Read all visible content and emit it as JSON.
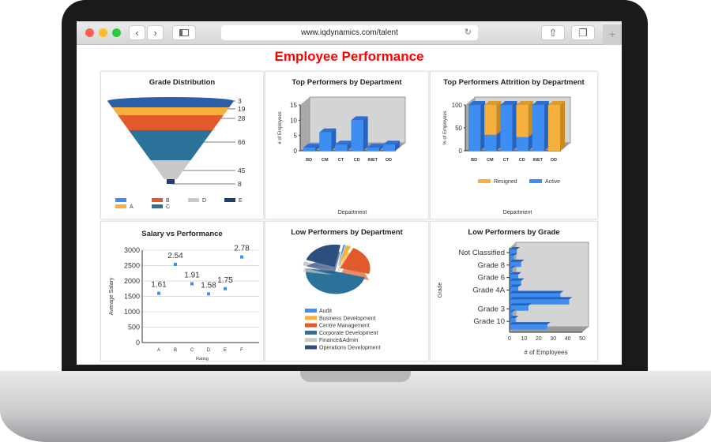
{
  "browser": {
    "url": "www.iqdynamics.com/talent",
    "back": "‹",
    "forward": "›",
    "new_tab": "+"
  },
  "page": {
    "title": "Employee Performance"
  },
  "colors": {
    "blue": "#3d8ef0",
    "orange": "#f6b03d",
    "red": "#e05a2b",
    "teal": "#2a7299",
    "gray": "#c8c8c8",
    "navy": "#1f3d6e"
  },
  "chart_data": [
    {
      "type": "funnel",
      "title": "Grade Distribution",
      "values": [
        3,
        19,
        28,
        66,
        45,
        8
      ],
      "colors": [
        "#2b5fa8",
        "#f6b03d",
        "#e05a2b",
        "#2a7299",
        "#c8c8c8",
        "#1f3d6e"
      ],
      "legend": [
        {
          "label": "",
          "color": "#3d8ef0"
        },
        {
          "label": "B",
          "color": "#e05a2b"
        },
        {
          "label": "D",
          "color": "#c8c8c8"
        },
        {
          "label": "E",
          "color": "#1f3d6e"
        },
        {
          "label": "A",
          "color": "#f6b03d"
        },
        {
          "label": "C",
          "color": "#2a7299"
        }
      ]
    },
    {
      "type": "bar",
      "title": "Top Performers by Department",
      "categories": [
        "BD",
        "CM",
        "CT",
        "CD",
        "INET",
        "OD"
      ],
      "values": [
        1,
        6,
        2,
        10,
        1,
        2
      ],
      "ylim": [
        0,
        15
      ],
      "yticks": [
        "0",
        "5",
        "10",
        "15"
      ],
      "xlabel": "Department",
      "ylabel": "# of Employees"
    },
    {
      "type": "bar",
      "stacked": true,
      "title": "Top Performers Attrition by Department",
      "categories": [
        "BD",
        "CM",
        "CT",
        "CD",
        "INET",
        "OD"
      ],
      "series": [
        {
          "name": "Active",
          "values": [
            100,
            35,
            100,
            30,
            100,
            0
          ]
        },
        {
          "name": "Resigned",
          "values": [
            0,
            65,
            0,
            70,
            0,
            100
          ]
        }
      ],
      "ylim": [
        0,
        100
      ],
      "yticks": [
        "0",
        "50",
        "100"
      ],
      "xlabel": "Department",
      "ylabel": "% of Employees"
    },
    {
      "type": "scatter",
      "title": "Salary vs Performance",
      "categories": [
        "A",
        "B",
        "C",
        "D",
        "E",
        "F"
      ],
      "values": [
        1600,
        2540,
        1910,
        1580,
        1750,
        2780
      ],
      "labels": [
        "1.61",
        "2.54",
        "1.91",
        "1.58",
        "1.75",
        "2.78"
      ],
      "ylim": [
        0,
        3000
      ],
      "yticks": [
        "0",
        "500",
        "1000",
        "1500",
        "2000",
        "2500",
        "3000"
      ],
      "xlabel": "Rating",
      "ylabel": "Average Salary"
    },
    {
      "type": "pie",
      "title": "Low Performers by Department",
      "slices": [
        {
          "label": "Audit",
          "value": 1,
          "color": "#3d8ef0"
        },
        {
          "label": "Business Development",
          "value": 3,
          "color": "#f6b03d"
        },
        {
          "label": "Centre Management",
          "value": 22,
          "color": "#e05a2b"
        },
        {
          "label": "Corporate Development",
          "value": 48,
          "color": "#2a7299"
        },
        {
          "label": "Finance&Admin",
          "value": 3,
          "color": "#c8c8c8"
        },
        {
          "label": "Operations Development",
          "value": 23,
          "color": "#2d4f80"
        }
      ]
    },
    {
      "type": "bar",
      "orientation": "horizontal",
      "title": "Low Performers by Grade",
      "bars": [
        {
          "label": "Not Classified",
          "value": 5
        },
        {
          "label": "",
          "value": 3
        },
        {
          "label": "Grade 8",
          "value": 8
        },
        {
          "label": "",
          "value": 2
        },
        {
          "label": "Grade 6",
          "value": 6
        },
        {
          "label": "",
          "value": 8
        },
        {
          "label": "Grade 4A",
          "value": 6
        },
        {
          "label": "",
          "value": 35
        },
        {
          "label": "",
          "value": 41
        },
        {
          "label": "Grade 3",
          "value": 13
        },
        {
          "label": "",
          "value": 2
        },
        {
          "label": "Grade 10",
          "value": 4
        },
        {
          "label": "",
          "value": 26
        }
      ],
      "xlim": [
        0,
        50
      ],
      "xticks": [
        "0",
        "10",
        "20",
        "30",
        "40",
        "50"
      ],
      "xlabel": "# of Employees",
      "ylabel": "Grade"
    }
  ]
}
